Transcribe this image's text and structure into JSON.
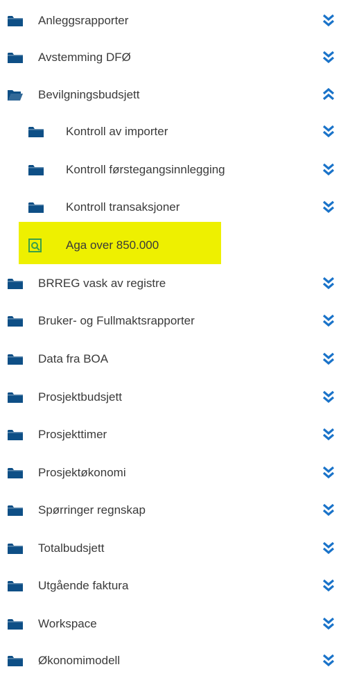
{
  "tree": {
    "items": [
      {
        "label": "Anleggsrapporter",
        "level": 0,
        "type": "folder",
        "open": false
      },
      {
        "label": "Avstemming DFØ",
        "level": 0,
        "type": "folder",
        "open": false
      },
      {
        "label": "Bevilgningsbudsjett",
        "level": 0,
        "type": "folder",
        "open": true
      },
      {
        "label": "Kontroll av importer",
        "level": 1,
        "type": "folder",
        "open": false
      },
      {
        "label": "Kontroll førstegangsinnlegging",
        "level": 1,
        "type": "folder",
        "open": false
      },
      {
        "label": "Kontroll transaksjoner",
        "level": 1,
        "type": "folder",
        "open": false
      },
      {
        "label": "Aga over 850.000",
        "level": 1,
        "type": "report",
        "highlighted": true
      },
      {
        "label": "BRREG vask av registre",
        "level": 0,
        "type": "folder",
        "open": false
      },
      {
        "label": "Bruker- og Fullmaktsrapporter",
        "level": 0,
        "type": "folder",
        "open": false
      },
      {
        "label": "Data fra BOA",
        "level": 0,
        "type": "folder",
        "open": false
      },
      {
        "label": "Prosjektbudsjett",
        "level": 0,
        "type": "folder",
        "open": false
      },
      {
        "label": "Prosjekttimer",
        "level": 0,
        "type": "folder",
        "open": false
      },
      {
        "label": "Prosjektøkonomi",
        "level": 0,
        "type": "folder",
        "open": false
      },
      {
        "label": "Spørringer regnskap",
        "level": 0,
        "type": "folder",
        "open": false
      },
      {
        "label": "Totalbudsjett",
        "level": 0,
        "type": "folder",
        "open": false
      },
      {
        "label": "Utgående faktura",
        "level": 0,
        "type": "folder",
        "open": false
      },
      {
        "label": "Workspace",
        "level": 0,
        "type": "folder",
        "open": false
      },
      {
        "label": "Økonomimodell",
        "level": 0,
        "type": "folder",
        "open": false
      }
    ]
  },
  "colors": {
    "folder": "#0e4f86",
    "chevron": "#1a73c9",
    "highlight": "#eef000",
    "report_icon": "#3aa04a"
  },
  "icons": {
    "folder_closed": "folder-icon",
    "folder_open": "folder-open-icon",
    "report": "report-search-icon",
    "expand": "chevron-double-down-icon",
    "collapse": "chevron-double-up-icon"
  }
}
